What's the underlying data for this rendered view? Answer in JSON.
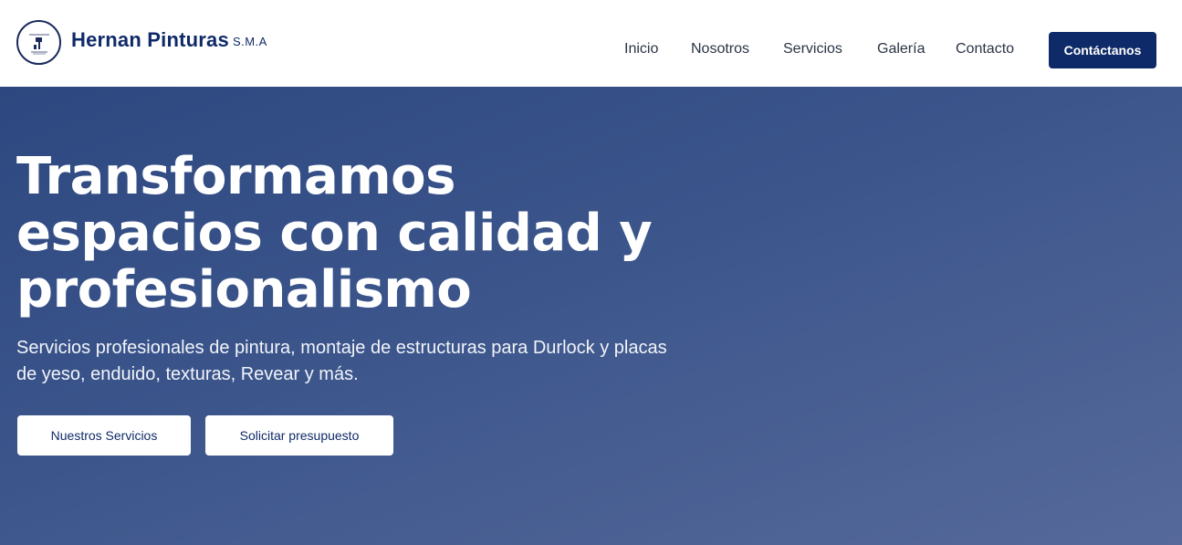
{
  "brand": {
    "name": "Hernan Pinturas",
    "suffix": "S.M.A",
    "logo_icon": "paint-roller-icon"
  },
  "nav": {
    "items": [
      {
        "label": "Inicio"
      },
      {
        "label": "Nosotros"
      },
      {
        "label": "Servicios"
      },
      {
        "label": "Galería"
      },
      {
        "label": "Contacto"
      }
    ],
    "cta_label": "Contáctanos"
  },
  "hero": {
    "title_lines": [
      "Transformamos",
      "espacios con calidad y",
      "profesionalismo"
    ],
    "subtitle_lines": [
      "Servicios profesionales de pintura, montaje de estructuras para Durlock y placas",
      "de yeso, enduido, texturas, Revear y más."
    ],
    "primary_button": "Nuestros Servicios",
    "secondary_button": "Solicitar presupuesto"
  },
  "colors": {
    "brand": "#0f2a68",
    "hero_gradient_start": "#2d4880",
    "hero_gradient_end": "#56699a",
    "nav_text": "#2a3444"
  }
}
